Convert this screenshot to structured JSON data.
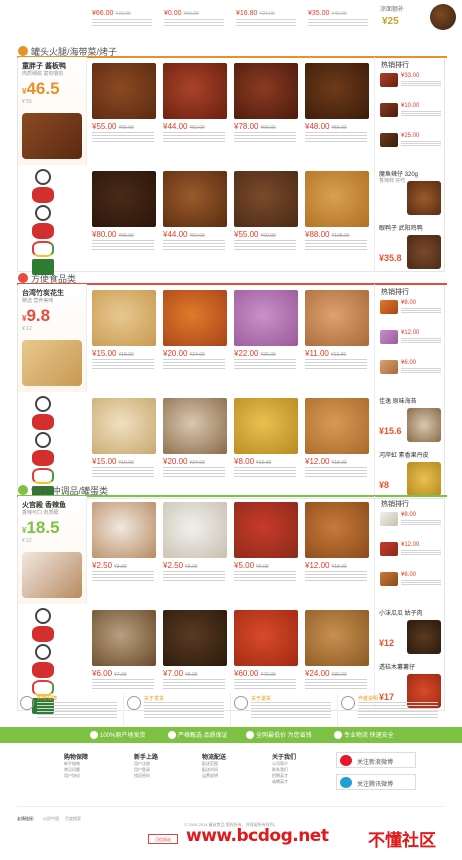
{
  "colors": {
    "orange": "#e8912a",
    "green": "#7dc242",
    "price": "#e53a25"
  },
  "top_strip": {
    "prices": [
      "¥66.00",
      "¥0.00",
      "¥16.80",
      "¥35.00"
    ],
    "origs": [
      "¥73.00",
      "¥99.99",
      "¥24.00",
      "¥40.00"
    ],
    "thumb_text": "凉面额补",
    "thumb_num": "¥25"
  },
  "sections": [
    {
      "title": "罐头火腿/海带菜/烤子",
      "promo": {
        "name": "童胖子 酱板鸭",
        "sub": "肉质细腻 富有嚼劲",
        "price": "46.5",
        "orig": "¥ 55"
      },
      "row1": [
        {
          "price": "¥55.00",
          "orig": "¥66.00"
        },
        {
          "price": "¥44.00",
          "orig": "¥52.00"
        },
        {
          "price": "¥78.00",
          "orig": "¥90.00"
        },
        {
          "price": "¥48.00",
          "orig": "¥56.00"
        }
      ],
      "row2": [
        {
          "price": "¥80.00",
          "orig": "¥99.00"
        },
        {
          "price": "¥44.00",
          "orig": "¥52.00"
        },
        {
          "price": "¥55.00",
          "orig": "¥69.00"
        },
        {
          "price": "¥88.00",
          "orig": "¥108.00"
        }
      ],
      "rank_title": "热销排行",
      "rank": [
        {
          "p": "¥33.00"
        },
        {
          "p": "¥10.00"
        },
        {
          "p": "¥25.00"
        }
      ],
      "feat": [
        {
          "t": "魔鱼辣仔 320g",
          "t2": "香辣鲜 好吃",
          "p": ""
        },
        {
          "t": "眼鸭子 武阳鸡鸭",
          "t2": "",
          "p": "¥35.8"
        }
      ]
    },
    {
      "title": "方便食品类",
      "promo": {
        "name": "台湾竹炭花生",
        "sub": "精选 营养美味",
        "price": "9.8",
        "orig": "¥ 12"
      },
      "row1": [
        {
          "price": "¥15.00",
          "orig": "¥18.00"
        },
        {
          "price": "¥20.00",
          "orig": "¥24.00"
        },
        {
          "price": "¥22.00",
          "orig": "¥26.00"
        },
        {
          "price": "¥11.00",
          "orig": "¥13.00"
        }
      ],
      "row2": [
        {
          "price": "¥15.00",
          "orig": "¥19.00"
        },
        {
          "price": "¥20.00",
          "orig": "¥24.00"
        },
        {
          "price": "¥8.00",
          "orig": "¥10.00"
        },
        {
          "price": "¥12.00",
          "orig": "¥15.00"
        }
      ],
      "rank_title": "热销排行",
      "rank": [
        {
          "p": "¥8.00"
        },
        {
          "p": "¥12.00"
        },
        {
          "p": "¥6.00"
        }
      ],
      "feat": [
        {
          "t": "佳逸 原味海苔",
          "t2": "",
          "p": "¥15.6"
        },
        {
          "t": "河岸虹 素香果丹皮",
          "t2": "",
          "p": "¥8"
        }
      ]
    },
    {
      "title": "饮料/冲调品/罐蛋类",
      "promo": {
        "name": "火宫殿 香辣鱼",
        "sub": "香辣可口 肉质细",
        "price": "18.5",
        "orig": "¥ 22"
      },
      "row1": [
        {
          "price": "¥2.50",
          "orig": "¥3.00"
        },
        {
          "price": "¥2.50",
          "orig": "¥3.00"
        },
        {
          "price": "¥5.00",
          "orig": "¥6.00"
        },
        {
          "price": "¥12.00",
          "orig": "¥15.00"
        }
      ],
      "row2": [
        {
          "price": "¥6.00",
          "orig": "¥7.00"
        },
        {
          "price": "¥7.00",
          "orig": "¥9.00"
        },
        {
          "price": "¥60.00",
          "orig": "¥72.00"
        },
        {
          "price": "¥24.00",
          "orig": "¥30.00"
        }
      ],
      "rank_title": "热销排行",
      "rank": [
        {
          "p": "¥8.00"
        },
        {
          "p": "¥12.00"
        },
        {
          "p": "¥6.00"
        }
      ],
      "feat": [
        {
          "t": "小沫瓜瓜 姑子肉",
          "t2": "",
          "p": "¥12"
        },
        {
          "t": "透桔木薯薯仔",
          "t2": "",
          "p": "¥17"
        }
      ]
    }
  ],
  "guarantees": [
    {
      "title": "购物保障"
    },
    {
      "title": "关于发货"
    },
    {
      "title": "关于退货"
    },
    {
      "title": "作者说明"
    }
  ],
  "greenbar": [
    "100%原产地发货",
    "严格甄选 品质保证",
    "全网最低价 为您省钱",
    "专业物流 快速安全"
  ],
  "footer": {
    "cols": [
      {
        "h": "购物保障",
        "l": [
          "新手指南",
          "常见问题",
          "用户协议"
        ]
      },
      {
        "h": "新手上路",
        "l": [
          "用户注册",
          "用户登录",
          "找回密码"
        ]
      },
      {
        "h": "物流配送",
        "l": [
          "配送范围",
          "配送时间",
          "运费说明"
        ]
      },
      {
        "h": "关于我们",
        "l": [
          "公司简介",
          "联系我们",
          "招聘英才",
          "诚聘英才"
        ]
      }
    ],
    "weibo": [
      "关注新浪微博",
      "关注腾讯微博"
    ],
    "partners_label": "友情链接：",
    "partners": [
      "以初中国",
      "百度搜索"
    ],
    "copyright1": "© 2005-2014 童叔食品 版权所有，并保留所有权利。",
    "badge": "可信网站",
    "watermark_url": "www.bcdog.net",
    "watermark_cn": "不懂社区"
  }
}
